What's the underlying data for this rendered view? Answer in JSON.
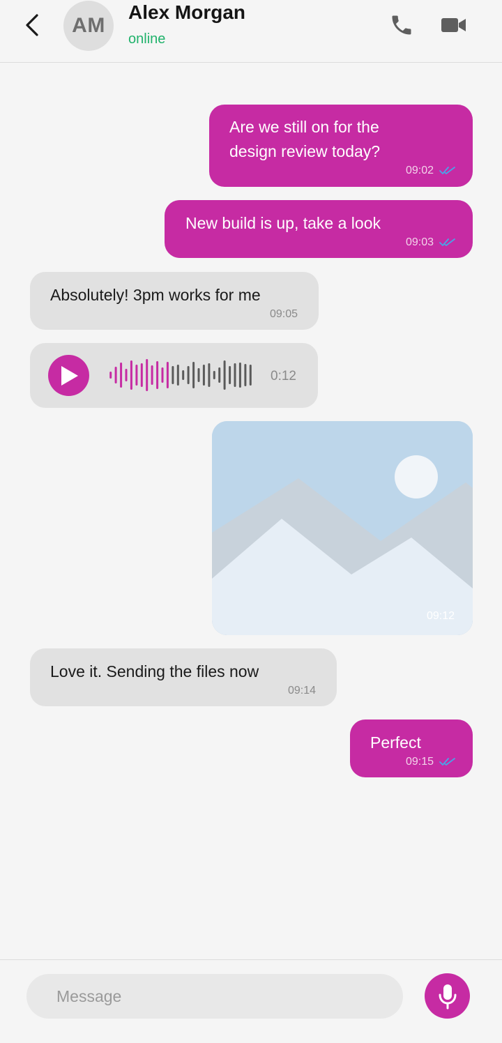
{
  "header": {
    "avatar_initials": "AM",
    "name": "Alex Morgan",
    "status": "online",
    "icons": {
      "back": "chevron-left-icon",
      "call": "phone-icon",
      "video": "video-camera-icon"
    }
  },
  "messages": [
    {
      "direction": "outgoing",
      "text_lines": [
        "Are we still on for the",
        "design review today?"
      ],
      "time": "09:02",
      "status": "read"
    },
    {
      "direction": "outgoing",
      "text": "New build is up, take a look",
      "time": "09:03",
      "status": "read"
    },
    {
      "direction": "incoming",
      "text": "Absolutely! 3pm works for me",
      "time": "09:05"
    },
    {
      "direction": "incoming",
      "type": "voice",
      "duration": "0:12",
      "played_fraction": 0.4
    },
    {
      "direction": "outgoing",
      "type": "image",
      "time": "09:12"
    },
    {
      "direction": "incoming",
      "text": "Love it. Sending the files now",
      "time": "09:14"
    },
    {
      "direction": "outgoing",
      "text": "Perfect",
      "time": "09:15",
      "status": "read"
    }
  ],
  "composer": {
    "placeholder": "Message",
    "icons": {
      "mic": "microphone-icon"
    }
  },
  "colors": {
    "accent": "#c62ba3",
    "online": "#20b26b",
    "incoming_bubble": "#e1e1e1",
    "read_ticks": "#4aa3e8",
    "background": "#f5f5f5"
  }
}
